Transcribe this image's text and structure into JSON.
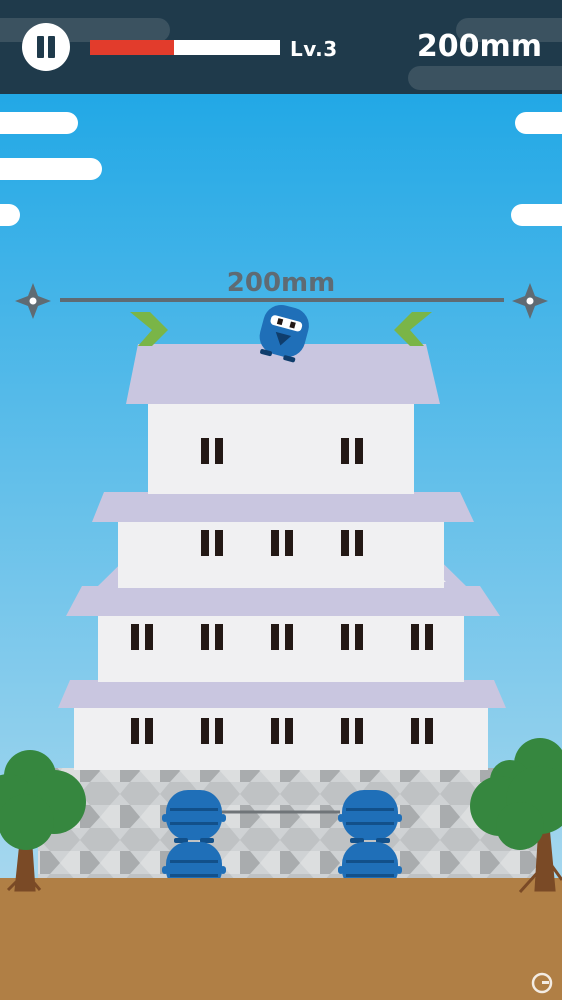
{
  "hud": {
    "pause_icon": "pause-icon",
    "level_label": "Lv.3",
    "height_value": "200mm",
    "progress": 0.44,
    "progress_color": "#e23c2c"
  },
  "game": {
    "measure_label": "200mm",
    "sky_top_color": "#22a8e6",
    "sky_bottom_color": "#a8d8ee",
    "ground_color": "#b07f45",
    "ninja_color": "#1f6fb8",
    "roof_color": "#c9c6e0",
    "wall_color": "#f0f0f2"
  },
  "icons": {
    "left_marker": "shuriken-icon",
    "right_marker": "shuriken-icon",
    "watermark": "site-logo-icon"
  }
}
